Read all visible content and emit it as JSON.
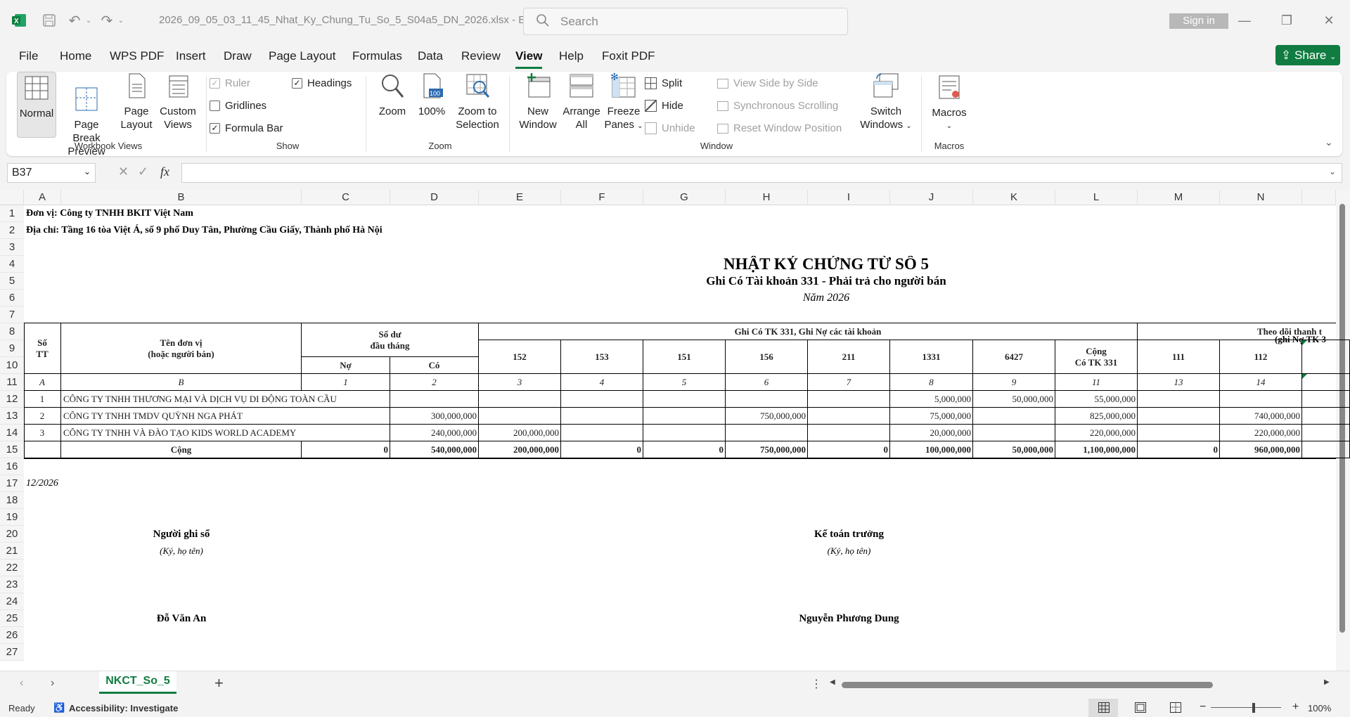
{
  "titlebar": {
    "filename": "2026_09_05_03_11_45_Nhat_Ky_Chung_Tu_So_5_S04a5_DN_2026.xlsx  -  E...",
    "search_placeholder": "Search",
    "signin": "Sign in"
  },
  "menu": [
    "File",
    "Home",
    "WPS PDF",
    "Insert",
    "Draw",
    "Page Layout",
    "Formulas",
    "Data",
    "Review",
    "View",
    "Help",
    "Foxit PDF"
  ],
  "share": "Share",
  "ribbon": {
    "workbook_views": {
      "label": "Workbook Views",
      "normal": "Normal",
      "page_break": "Page Break\nPreview",
      "page_layout": "Page\nLayout",
      "custom": "Custom\nViews"
    },
    "show": {
      "label": "Show",
      "ruler": "Ruler",
      "gridlines": "Gridlines",
      "formula_bar": "Formula Bar",
      "headings": "Headings"
    },
    "zoom": {
      "label": "Zoom",
      "zoom": "Zoom",
      "hundred": "100%",
      "zoom_sel": "Zoom to\nSelection"
    },
    "window": {
      "label": "Window",
      "new_window": "New\nWindow",
      "arrange_all": "Arrange\nAll",
      "freeze": "Freeze\nPanes",
      "split": "Split",
      "hide": "Hide",
      "unhide": "Unhide",
      "side_by_side": "View Side by Side",
      "sync_scroll": "Synchronous Scrolling",
      "reset_pos": "Reset Window Position",
      "switch": "Switch\nWindows"
    },
    "macros": {
      "label": "Macros",
      "macros": "Macros"
    }
  },
  "namebox": "B37",
  "columns": [
    "A",
    "B",
    "C",
    "D",
    "E",
    "F",
    "G",
    "H",
    "I",
    "J",
    "K",
    "L",
    "M",
    "N"
  ],
  "rows": [
    "1",
    "2",
    "3",
    "4",
    "5",
    "6",
    "7",
    "8",
    "9",
    "10",
    "11",
    "12",
    "13",
    "14",
    "15",
    "16",
    "17",
    "18",
    "19",
    "20",
    "21",
    "22",
    "23",
    "24",
    "25",
    "26",
    "27"
  ],
  "sheet": {
    "unit": "Đơn vị: Công ty TNHH BKIT Việt Nam",
    "address": "Địa chỉ: Tầng 16 tòa Việt Á, số 9 phố Duy Tân, Phường Cầu Giấy, Thành phố Hà Nội",
    "title": "NHẬT KÝ CHỨNG TỪ SỐ 5",
    "subtitle": "Ghi Có Tài khoản 331 - Phải trả cho người bán",
    "year": "Năm 2026",
    "h_stt": "Số\nTT",
    "h_name": "Tên đơn vị\n(hoặc người bán)",
    "h_opening": "Số dư\nđầu tháng",
    "h_no": "Nợ",
    "h_co": "Có",
    "h_credit": "Ghi Có TK 331, Ghi Nợ các tài khoản",
    "h_accounts": [
      "152",
      "153",
      "151",
      "156",
      "211",
      "1331",
      "6427"
    ],
    "h_total": "Cộng\nCó TK 331",
    "h_track": "Theo dõi thanh t",
    "h_track2": "(ghi Nợ TK 3",
    "h_track_accounts": [
      "111",
      "112"
    ],
    "idx": [
      "A",
      "B",
      "1",
      "2",
      "3",
      "4",
      "5",
      "6",
      "7",
      "8",
      "9",
      "11",
      "13",
      "14"
    ],
    "rows": [
      {
        "stt": "1",
        "name": "CÔNG TY TNHH THƯƠNG MẠI VÀ DỊCH VỤ DI ĐỘNG TOÀN CẦU",
        "no": "",
        "co": "",
        "a152": "",
        "a153": "",
        "a151": "",
        "a156": "",
        "a211": "",
        "a1331": "5,000,000",
        "a6427": "50,000,000",
        "total": "55,000,000",
        "a111": "",
        "a112": ""
      },
      {
        "stt": "2",
        "name": "CÔNG TY TNHH TMDV QUỲNH NGA PHÁT",
        "no": "",
        "co": "300,000,000",
        "a152": "",
        "a153": "",
        "a151": "",
        "a156": "750,000,000",
        "a211": "",
        "a1331": "75,000,000",
        "a6427": "",
        "total": "825,000,000",
        "a111": "",
        "a112": "740,000,000"
      },
      {
        "stt": "3",
        "name": "CÔNG TY TNHH VÀ ĐÀO TẠO KIDS WORLD ACADEMY",
        "no": "",
        "co": "240,000,000",
        "a152": "200,000,000",
        "a153": "",
        "a151": "",
        "a156": "",
        "a211": "",
        "a1331": "20,000,000",
        "a6427": "",
        "total": "220,000,000",
        "a111": "",
        "a112": "220,000,000"
      }
    ],
    "totals": {
      "label": "Cộng",
      "no": "0",
      "co": "540,000,000",
      "a152": "200,000,000",
      "a153": "0",
      "a151": "0",
      "a156": "750,000,000",
      "a211": "0",
      "a1331": "100,000,000",
      "a6427": "50,000,000",
      "total": "1,100,000,000",
      "a111": "0",
      "a112": "960,000,000"
    },
    "date": "12/2026",
    "signer1_title": "Người ghi sổ",
    "signer1_note": "(Ký, họ tên)",
    "signer2_title": "Kế toán trưởng",
    "signer2_note": "(Ký, họ tên)",
    "signer1_name": "Đỗ Văn An",
    "signer2_name": "Nguyễn Phương Dung"
  },
  "sheet_tab": "NKCT_So_5",
  "status": {
    "ready": "Ready",
    "accessibility": "Accessibility: Investigate",
    "zoom": "100%"
  }
}
